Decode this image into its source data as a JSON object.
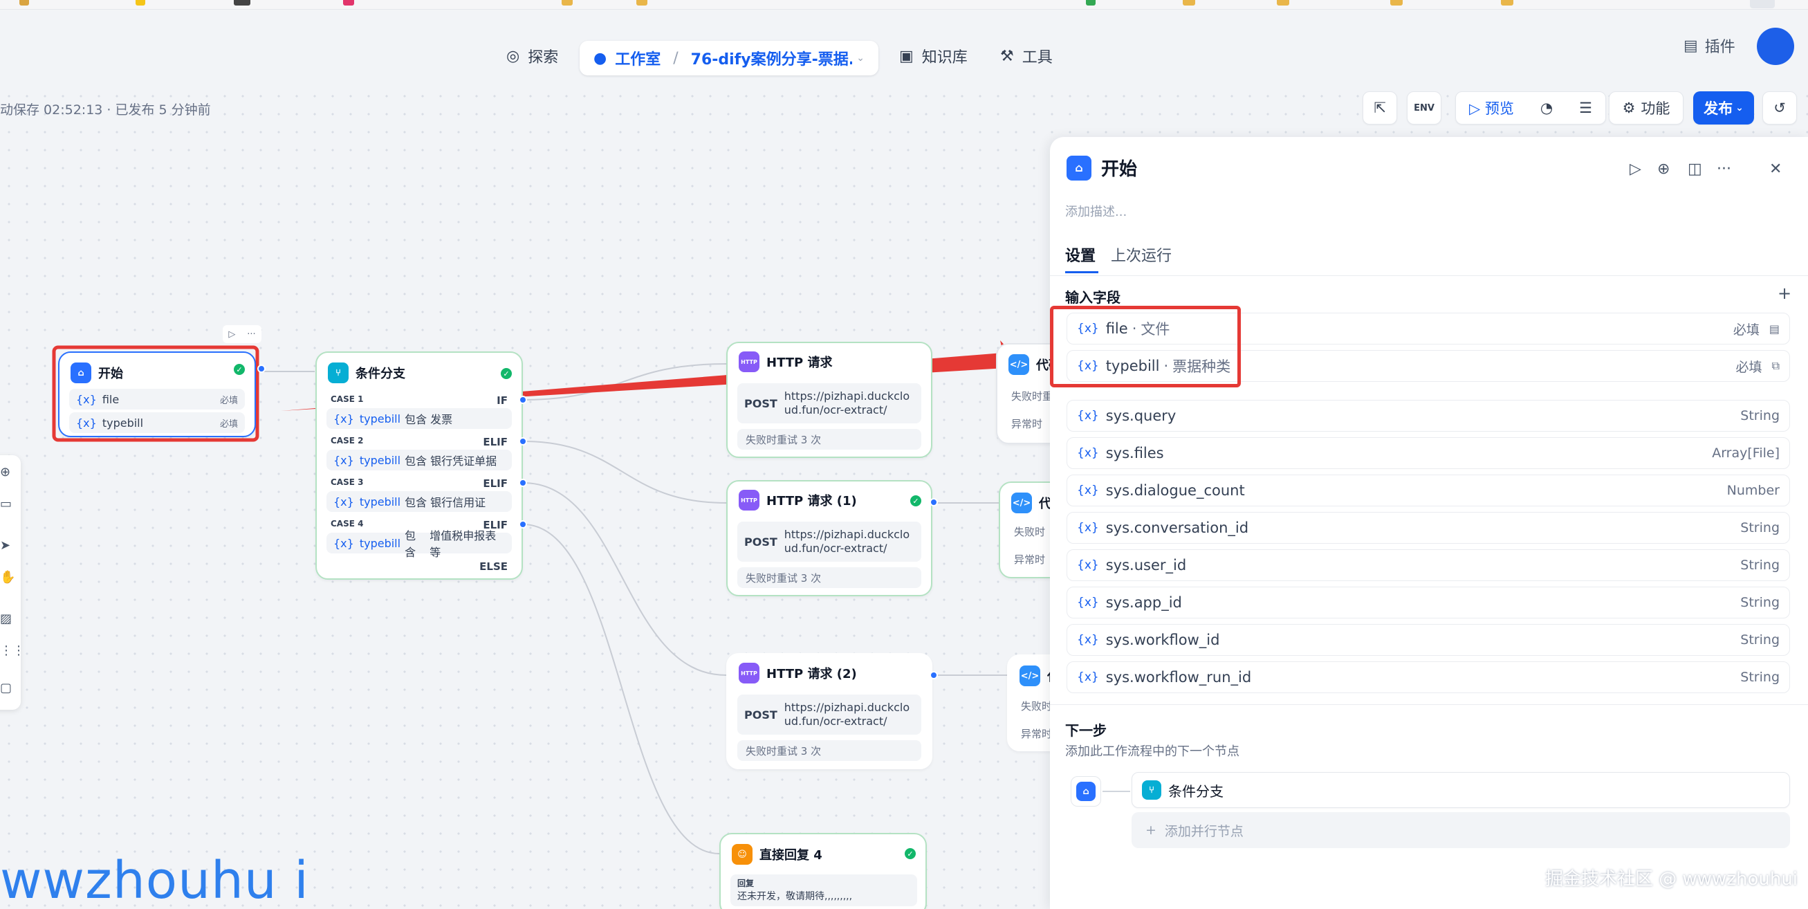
{
  "header": {
    "nav_explore": "探索",
    "nav_studio": "工作室",
    "app_name": "76-dify案例分享-票据...",
    "nav_knowledge": "知识库",
    "nav_tools": "工具",
    "plugins": "插件"
  },
  "toolbar": {
    "autosave": "动保存 02:52:13 · 已发布 5 分钟前",
    "env": "ENV",
    "preview": "预览",
    "features": "功能",
    "publish": "发布"
  },
  "nodes": {
    "start": {
      "title": "开始",
      "fields": [
        {
          "name": "file",
          "req": "必填"
        },
        {
          "name": "typebill",
          "req": "必填"
        }
      ]
    },
    "ifelse": {
      "title": "条件分支",
      "cases": [
        {
          "label": "CASE 1",
          "kw": "IF",
          "var": "typebill",
          "op": "包含",
          "val": "发票"
        },
        {
          "label": "CASE 2",
          "kw": "ELIF",
          "var": "typebill",
          "op": "包含",
          "val": "银行凭证单据"
        },
        {
          "label": "CASE 3",
          "kw": "ELIF",
          "var": "typebill",
          "op": "包含",
          "val": "银行信用证"
        },
        {
          "label": "CASE 4",
          "kw": "ELIF",
          "var": "typebill",
          "op": "包含",
          "val": "增值税申报表等"
        }
      ],
      "else": "ELSE"
    },
    "http": [
      {
        "title": "HTTP 请求",
        "method": "POST",
        "url": "https://pizhapi.duckcloud.fun/ocr-extract/",
        "retry": "失败时重试 3 次"
      },
      {
        "title": "HTTP 请求 (1)",
        "method": "POST",
        "url": "https://pizhapi.duckcloud.fun/ocr-extract/",
        "retry": "失败时重试 3 次"
      },
      {
        "title": "HTTP 请求 (2)",
        "method": "POST",
        "url": "https://pizhapi.duckcloud.fun/ocr-extract/",
        "retry": "失败时重试 3 次"
      }
    ],
    "code_partial": [
      {
        "title": "代码",
        "l1": "失败时重",
        "l2": "异常时"
      },
      {
        "title": "代",
        "l1": "失败时",
        "l2": "异常时"
      },
      {
        "title": "代",
        "l1": "失败时",
        "l2": "异常时"
      }
    ],
    "answer": {
      "title": "直接回复 4",
      "label": "回复",
      "text": "还未开发，敬请期待,,,,,,,,,"
    }
  },
  "panel": {
    "title": "开始",
    "desc_placeholder": "添加描述...",
    "tabs": [
      "设置",
      "上次运行"
    ],
    "input_section": "输入字段",
    "inputs": [
      {
        "name": "file",
        "desc": "文件",
        "req": "必填"
      },
      {
        "name": "typebill",
        "desc": "票据种类",
        "req": "必填"
      }
    ],
    "sys_vars": [
      {
        "name": "sys.query",
        "type": "String"
      },
      {
        "name": "sys.files",
        "type": "Array[File]"
      },
      {
        "name": "sys.dialogue_count",
        "type": "Number"
      },
      {
        "name": "sys.conversation_id",
        "type": "String"
      },
      {
        "name": "sys.user_id",
        "type": "String"
      },
      {
        "name": "sys.app_id",
        "type": "String"
      },
      {
        "name": "sys.workflow_id",
        "type": "String"
      },
      {
        "name": "sys.workflow_run_id",
        "type": "String"
      }
    ],
    "next_section": "下一步",
    "next_desc": "添加此工作流程中的下一个节点",
    "next_node": "条件分支",
    "add_parallel": "添加并行节点"
  },
  "watermark": {
    "left": "wwzhouhu i",
    "right": "掘金技术社区 @ wwwzhouhui"
  },
  "colors": {
    "accent": "#155eef",
    "highlight": "#e53935",
    "success": "#12b76a"
  }
}
